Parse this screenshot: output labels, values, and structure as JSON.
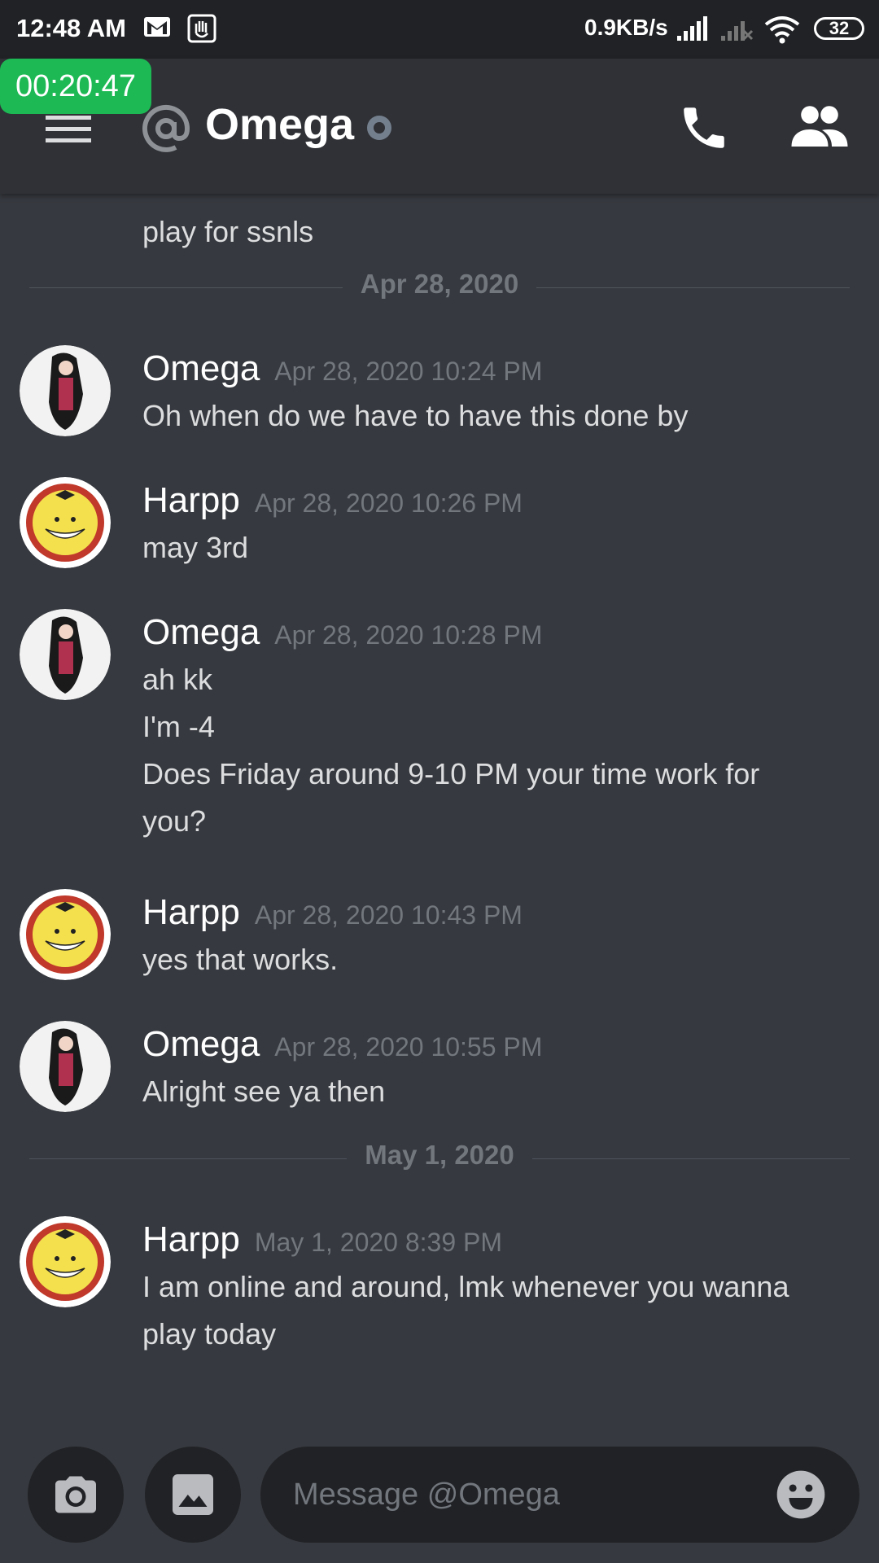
{
  "status_bar": {
    "time": "12:48 AM",
    "network_speed": "0.9KB/s",
    "battery": "32",
    "icons": [
      "mail-icon",
      "app-notification-icon",
      "signal-icon",
      "signal-no-data-icon",
      "wifi-icon",
      "battery-icon"
    ]
  },
  "timer": "00:20:47",
  "header": {
    "channel_name": "Omega",
    "icons": [
      "menu-icon",
      "at-icon",
      "status-dot-icon",
      "call-icon",
      "members-icon"
    ]
  },
  "chat": {
    "clipped_line": "play for ssnls",
    "dividers": [
      "Apr 28, 2020",
      "May 1, 2020"
    ],
    "messages": [
      {
        "author": "Omega",
        "timestamp": "Apr 28, 2020 10:24 PM",
        "lines": [
          "Oh when do we have to have this done by"
        ]
      },
      {
        "author": "Harpp",
        "timestamp": "Apr 28, 2020 10:26 PM",
        "lines": [
          "may 3rd"
        ]
      },
      {
        "author": "Omega",
        "timestamp": "Apr 28, 2020 10:28 PM",
        "lines": [
          "ah kk",
          "I'm -4",
          "Does Friday around 9-10 PM your time work for",
          "you?"
        ]
      },
      {
        "author": "Harpp",
        "timestamp": "Apr 28, 2020 10:43 PM",
        "lines": [
          "yes that works."
        ]
      },
      {
        "author": "Omega",
        "timestamp": "Apr 28, 2020 10:55 PM",
        "lines": [
          "Alright see ya then"
        ]
      },
      {
        "author": "Harpp",
        "timestamp": "May 1, 2020 8:39 PM",
        "lines": [
          "I am online and around, lmk whenever you wanna",
          "play today"
        ]
      }
    ]
  },
  "input": {
    "placeholder": "Message @Omega",
    "icons": [
      "camera-icon",
      "gallery-icon",
      "emoji-icon"
    ]
  },
  "colors": {
    "background": "#36393f",
    "header": "#2f3136",
    "status_bar": "#202225",
    "timer": "#1db954",
    "muted_text": "#72767d"
  }
}
